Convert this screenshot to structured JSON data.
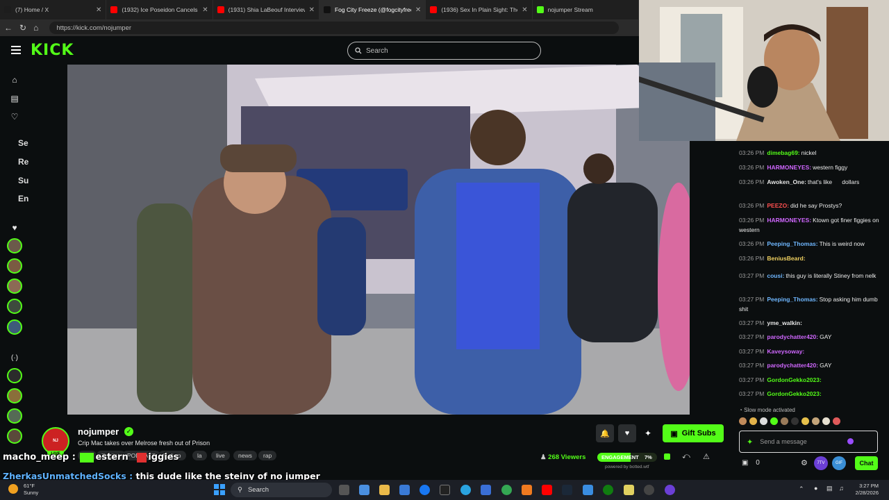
{
  "browser": {
    "tabs": [
      {
        "title": "(7) Home / X",
        "color": "#1d1d1d"
      },
      {
        "title": "(1932) Ice Poseidon Cancels Ama...",
        "color": "#ff0000"
      },
      {
        "title": "(1931) Shia LaBeouf Interview - Yo...",
        "color": "#ff0000"
      },
      {
        "title": "Fog City Freeze (@fogcityfreeze) | ...",
        "color": "#111111"
      },
      {
        "title": "(1936) Sex In Plain Sight: The Figu...",
        "color": "#ff0000"
      },
      {
        "title": "nojumper Stream",
        "color": "#53fc18"
      }
    ],
    "url": "https://kick.com/nojumper"
  },
  "kick": {
    "logo": "KICK",
    "search_placeholder": "Search",
    "accent": "#53fc18"
  },
  "sidebar": {
    "truncated_labels": [
      "Se",
      "Re",
      "Su",
      "En"
    ]
  },
  "chat": {
    "messages": [
      {
        "time": "03:26 PM",
        "user": "dimebag69:",
        "color": "#53fc18",
        "text": "nickel"
      },
      {
        "time": "03:26 PM",
        "user": "HARMONEYES:",
        "color": "#d067ff",
        "text": "western figgy"
      },
      {
        "time": "03:26 PM",
        "user": "Awoken_One:",
        "color": "#e6e6e6",
        "text": "that's like      dollars"
      },
      {
        "time": "03:26 PM",
        "user": "PEEZO:",
        "color": "#ff4f4f",
        "text": "did he say Prostys?"
      },
      {
        "time": "03:26 PM",
        "user": "HARMONEYES:",
        "color": "#d067ff",
        "text": "Ktown got finer figgies on western"
      },
      {
        "time": "03:26 PM",
        "user": "Peeping_Thomas:",
        "color": "#6fb7ff",
        "text": "This is weird now"
      },
      {
        "time": "03:26 PM",
        "user": "BeniusBeard:",
        "color": "#f0d060",
        "text": ""
      },
      {
        "time": "03:27 PM",
        "user": "cousi:",
        "color": "#6fb7ff",
        "text": "this guy is literally Stiney from nelk"
      },
      {
        "time": "03:27 PM",
        "user": "Peeping_Thomas:",
        "color": "#6fb7ff",
        "text": "Stop asking him dumb shit"
      },
      {
        "time": "03:27 PM",
        "user": "yme_walkin:",
        "color": "#e6e6e6",
        "text": ""
      },
      {
        "time": "03:27 PM",
        "user": "parodychatter420:",
        "color": "#d067ff",
        "text": "GAY"
      },
      {
        "time": "03:27 PM",
        "user": "Kaveysoway:",
        "color": "#d067ff",
        "text": ""
      },
      {
        "time": "03:27 PM",
        "user": "parodychatter420:",
        "color": "#d067ff",
        "text": "GAY"
      },
      {
        "time": "03:27 PM",
        "user": "GordonGekko2023:",
        "color": "#53fc18",
        "text": ""
      },
      {
        "time": "03:27 PM",
        "user": "GordonGekko2023:",
        "color": "#53fc18",
        "text": ""
      }
    ],
    "slow_mode": "Slow mode activated",
    "input_placeholder": "Send a message",
    "points": "0",
    "chat_button": "Chat"
  },
  "stream": {
    "channel": "nojumper",
    "title": "Crip Mac takes over Melrose fresh out of Prison",
    "live_badge": "LIVE",
    "tags": [
      "IRL",
      "English",
      "PODCAST",
      "hiphop",
      "la",
      "live",
      "news",
      "rap"
    ],
    "gift_button": "Gift Subs",
    "viewers": "268 Viewers",
    "engagement_label": "ENGAGEMENT",
    "engagement_value": "7%",
    "engagement_fraction": 0.07,
    "powered_by": "powered by botted.wtf"
  },
  "overlay": {
    "caption1_user": "macho_meep :",
    "caption1_parts": [
      "estern",
      "iggies"
    ],
    "caption2_user": "ZherkasUnmatchedSocks :",
    "caption2_text": "this dude like the steiny of no jumper"
  },
  "taskbar": {
    "weather_temp": "61°F",
    "weather_desc": "Sunny",
    "search": "Search",
    "time": "3:27 PM",
    "date": "2/28/2026"
  }
}
